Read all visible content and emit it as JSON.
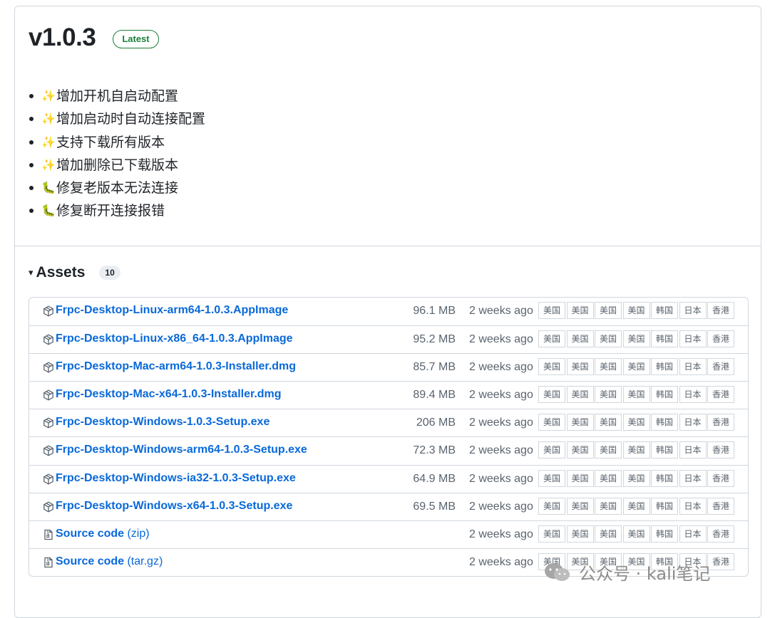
{
  "release": {
    "version": "v1.0.3",
    "badge": "Latest"
  },
  "notes": [
    {
      "emoji": "✨",
      "emoji_name": "sparkles",
      "text": "增加开机自启动配置"
    },
    {
      "emoji": "✨",
      "emoji_name": "sparkles",
      "text": "增加启动时自动连接配置"
    },
    {
      "emoji": "✨",
      "emoji_name": "sparkles",
      "text": "支持下载所有版本"
    },
    {
      "emoji": "✨",
      "emoji_name": "sparkles",
      "text": "增加删除已下载版本"
    },
    {
      "emoji": "🐛",
      "emoji_name": "bug",
      "text": "修复老版本无法连接"
    },
    {
      "emoji": "🐛",
      "emoji_name": "bug",
      "text": "修复断开连接报错"
    }
  ],
  "assets": {
    "title": "Assets",
    "count": "10",
    "caret": "▾",
    "mirror_labels": [
      "美国",
      "美国",
      "美国",
      "美国",
      "韩国",
      "日本",
      "香港"
    ],
    "rows": [
      {
        "name": "Frpc-Desktop-Linux-arm64-1.0.3.AppImage",
        "suffix": "",
        "size": "96.1 MB",
        "date": "2 weeks ago",
        "icon": "package-icon"
      },
      {
        "name": "Frpc-Desktop-Linux-x86_64-1.0.3.AppImage",
        "suffix": "",
        "size": "95.2 MB",
        "date": "2 weeks ago",
        "icon": "package-icon"
      },
      {
        "name": "Frpc-Desktop-Mac-arm64-1.0.3-Installer.dmg",
        "suffix": "",
        "size": "85.7 MB",
        "date": "2 weeks ago",
        "icon": "package-icon"
      },
      {
        "name": "Frpc-Desktop-Mac-x64-1.0.3-Installer.dmg",
        "suffix": "",
        "size": "89.4 MB",
        "date": "2 weeks ago",
        "icon": "package-icon"
      },
      {
        "name": "Frpc-Desktop-Windows-1.0.3-Setup.exe",
        "suffix": "",
        "size": "206 MB",
        "date": "2 weeks ago",
        "icon": "package-icon"
      },
      {
        "name": "Frpc-Desktop-Windows-arm64-1.0.3-Setup.exe",
        "suffix": "",
        "size": "72.3 MB",
        "date": "2 weeks ago",
        "icon": "package-icon"
      },
      {
        "name": "Frpc-Desktop-Windows-ia32-1.0.3-Setup.exe",
        "suffix": "",
        "size": "64.9 MB",
        "date": "2 weeks ago",
        "icon": "package-icon"
      },
      {
        "name": "Frpc-Desktop-Windows-x64-1.0.3-Setup.exe",
        "suffix": "",
        "size": "69.5 MB",
        "date": "2 weeks ago",
        "icon": "package-icon"
      },
      {
        "name": "Source code",
        "suffix": " (zip)",
        "size": "",
        "date": "2 weeks ago",
        "icon": "file-zip-icon"
      },
      {
        "name": "Source code",
        "suffix": " (tar.gz)",
        "size": "",
        "date": "2 weeks ago",
        "icon": "file-zip-icon"
      }
    ]
  },
  "watermark": {
    "text": "公众号 · kali笔记"
  },
  "colors": {
    "link": "#0969da",
    "latest_badge": "#1a7f37",
    "border": "#d0d7de",
    "muted": "#59636e"
  }
}
